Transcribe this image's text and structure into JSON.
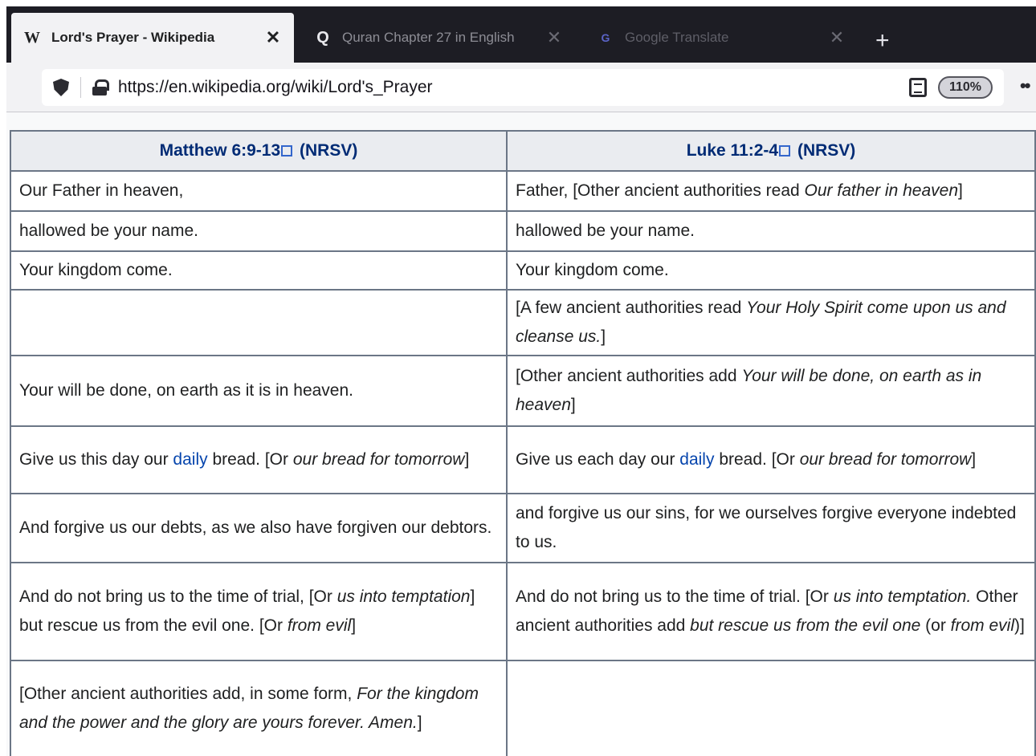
{
  "browser": {
    "tabs": [
      {
        "favicon": "W",
        "title": "Lord's Prayer - Wikipedia",
        "close": "✕",
        "active": true
      },
      {
        "favicon": "Q",
        "title": "Quran Chapter 27 in English",
        "close": "✕",
        "active": false
      },
      {
        "favicon": "G",
        "title": "Google Translate",
        "close": "✕",
        "active": false
      }
    ],
    "new_tab": "+",
    "url": "https://en.wikipedia.org/wiki/Lord's_Prayer",
    "zoom": "110%",
    "icons": {
      "shield": "shield-icon",
      "lock": "lock-icon",
      "reader": "reader-mode-icon",
      "more": "overflow-menu-icon"
    }
  },
  "table": {
    "headers": {
      "matthew": {
        "ref": "Matthew 6:9-13",
        "version": "(NRSV)"
      },
      "luke": {
        "ref": "Luke 11:2-4",
        "version": "(NRSV)"
      }
    },
    "rows": [
      {
        "left": [
          {
            "t": "Our Father in heaven,"
          }
        ],
        "right": [
          {
            "t": "Father, [Other ancient authorities read "
          },
          {
            "t": "Our father in heaven",
            "i": true
          },
          {
            "t": "]"
          }
        ]
      },
      {
        "left": [
          {
            "t": "hallowed be your name."
          }
        ],
        "right": [
          {
            "t": "hallowed be your name."
          }
        ]
      },
      {
        "left": [
          {
            "t": "Your kingdom come."
          }
        ],
        "right": [
          {
            "t": "Your kingdom come."
          }
        ]
      },
      {
        "left": [],
        "right": [
          {
            "t": "[A few ancient authorities read "
          },
          {
            "t": "Your Holy Spirit come upon us and cleanse us.",
            "i": true
          },
          {
            "t": "]"
          }
        ]
      },
      {
        "left": [
          {
            "t": "Your will be done, on earth as it is in heaven."
          }
        ],
        "right": [
          {
            "t": "[Other ancient authorities add "
          },
          {
            "t": "Your will be done, on earth as in heaven",
            "i": true
          },
          {
            "t": "]"
          }
        ]
      },
      {
        "left": [
          {
            "t": "Give us this day our "
          },
          {
            "t": "daily",
            "link": true
          },
          {
            "t": " bread. [Or "
          },
          {
            "t": "our bread for tomorrow",
            "i": true
          },
          {
            "t": "]"
          }
        ],
        "right": [
          {
            "t": "Give us each day our "
          },
          {
            "t": "daily",
            "link": true
          },
          {
            "t": " bread. [Or "
          },
          {
            "t": "our bread for tomorrow",
            "i": true
          },
          {
            "t": "]"
          }
        ]
      },
      {
        "left": [
          {
            "t": "And forgive us our debts, as we also have forgiven our debtors."
          }
        ],
        "right": [
          {
            "t": "and forgive us our sins, for we ourselves forgive everyone indebted to us."
          }
        ]
      },
      {
        "left": [
          {
            "t": "And do not bring us to the time of trial, [Or "
          },
          {
            "t": "us into temptation",
            "i": true
          },
          {
            "t": "] but rescue us from the evil one. [Or "
          },
          {
            "t": "from evil",
            "i": true
          },
          {
            "t": "]"
          }
        ],
        "right": [
          {
            "t": "And do not bring us to the time of trial. [Or "
          },
          {
            "t": "us into temptation.",
            "i": true
          },
          {
            "t": " Other ancient authorities add "
          },
          {
            "t": "but rescue us from the evil one",
            "i": true
          },
          {
            "t": " (or "
          },
          {
            "t": "from evil",
            "i": true
          },
          {
            "t": ")]"
          }
        ]
      },
      {
        "left": [
          {
            "t": "[Other ancient authorities add, in some form, "
          },
          {
            "t": "For the kingdom and the power and the glory are yours forever. Amen.",
            "i": true
          },
          {
            "t": "]"
          }
        ],
        "right": []
      }
    ]
  }
}
